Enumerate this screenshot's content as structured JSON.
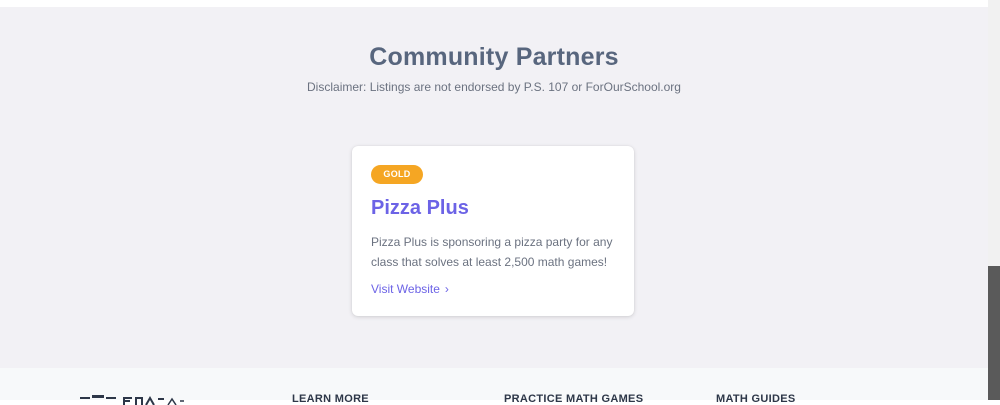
{
  "partners": {
    "title": "Community Partners",
    "disclaimer": "Disclaimer: Listings are not endorsed by P.S. 107 or ForOurSchool.org",
    "cards": [
      {
        "badge": "GOLD",
        "name": "Pizza Plus",
        "description": "Pizza Plus is sponsoring a pizza party for any class that solves at least 2,500 math games!",
        "link_label": "Visit Website",
        "link_icon": "chevron-right-icon"
      }
    ]
  },
  "footer": {
    "headings": [
      "LEARN MORE",
      "PRACTICE MATH GAMES",
      "MATH GUIDES"
    ]
  },
  "colors": {
    "accent": "#6c63e6",
    "badge_gold": "#f5a623",
    "section_bg": "#f2f1f5",
    "heading": "#58667e"
  }
}
